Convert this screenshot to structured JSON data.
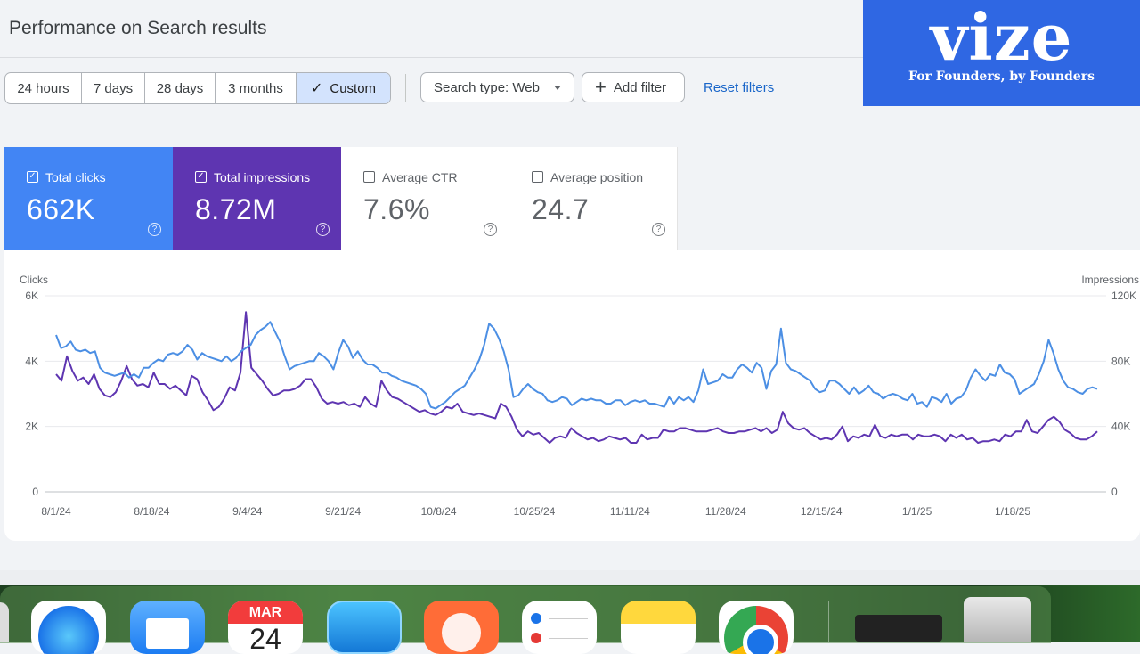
{
  "header": {
    "title": "Performance on Search results"
  },
  "date_ranges": [
    {
      "label": "24 hours",
      "active": false
    },
    {
      "label": "7 days",
      "active": false
    },
    {
      "label": "28 days",
      "active": false
    },
    {
      "label": "3 months",
      "active": false
    },
    {
      "label": "Custom",
      "active": true
    }
  ],
  "filters": {
    "search_type": "Search type: Web",
    "add_filter": "Add filter",
    "reset": "Reset filters"
  },
  "logo": {
    "word": "vize",
    "tagline": "For Founders, by Founders"
  },
  "metrics": {
    "clicks": {
      "label": "Total clicks",
      "value": "662K",
      "checked": true,
      "color": "#4285f4"
    },
    "impressions": {
      "label": "Total impressions",
      "value": "8.72M",
      "checked": true,
      "color": "#5e35b1"
    },
    "ctr": {
      "label": "Average CTR",
      "value": "7.6%",
      "checked": false
    },
    "position": {
      "label": "Average position",
      "value": "24.7",
      "checked": false
    }
  },
  "chart_data": {
    "type": "line",
    "ylabel_left": "Clicks",
    "ylabel_right": "Impressions",
    "y_left_ticks": [
      "0",
      "2K",
      "4K",
      "6K"
    ],
    "y_right_ticks": [
      "0",
      "40K",
      "80K",
      "120K"
    ],
    "ylim_left": [
      0,
      6000
    ],
    "ylim_right": [
      0,
      120000
    ],
    "x_ticks": [
      "8/1/24",
      "8/18/24",
      "9/4/24",
      "9/21/24",
      "10/8/24",
      "10/25/24",
      "11/11/24",
      "11/28/24",
      "12/15/24",
      "1/1/25",
      "1/18/25"
    ],
    "grid": true,
    "series": [
      {
        "name": "Clicks",
        "axis": "left",
        "color": "#5e35b1",
        "values": [
          3600,
          3400,
          4150,
          3700,
          3400,
          3500,
          3300,
          3600,
          3150,
          2950,
          2900,
          3050,
          3400,
          3850,
          3450,
          3250,
          3300,
          3200,
          3650,
          3300,
          3300,
          3150,
          3250,
          3100,
          2950,
          3550,
          3450,
          3050,
          2800,
          2500,
          2600,
          2850,
          3200,
          3100,
          3650,
          5500,
          3800,
          3600,
          3400,
          3150,
          2950,
          3000,
          3100,
          3100,
          3150,
          3250,
          3450,
          3450,
          3200,
          2850,
          2700,
          2750,
          2700,
          2750,
          2650,
          2700,
          2600,
          2900,
          2700,
          2600,
          3400,
          3100,
          2900,
          2850,
          2750,
          2650,
          2550,
          2450,
          2500,
          2400,
          2350,
          2450,
          2600,
          2550,
          2700,
          2450,
          2400,
          2350,
          2400,
          2350,
          2300,
          2250,
          2700,
          2600,
          2300,
          1900,
          1700,
          1850,
          1750,
          1800,
          1650,
          1500,
          1650,
          1700,
          1650,
          1950,
          1800,
          1700,
          1600,
          1650,
          1550,
          1600,
          1700,
          1650,
          1600,
          1650,
          1500,
          1500,
          1750,
          1600,
          1650,
          1650,
          1900,
          1850,
          1850,
          1950,
          1950,
          1900,
          1850,
          1850,
          1850,
          1900,
          1950,
          1850,
          1800,
          1800,
          1850,
          1850,
          1900,
          1950,
          1850,
          1950,
          1800,
          1900,
          2450,
          2100,
          1950,
          1900,
          1950,
          1800,
          1700,
          1600,
          1650,
          1600,
          1750,
          2000,
          1550,
          1700,
          1650,
          1750,
          1700,
          2050,
          1700,
          1650,
          1750,
          1700,
          1750,
          1750,
          1600,
          1750,
          1700,
          1700,
          1750,
          1700,
          1550,
          1750,
          1650,
          1750,
          1600,
          1650,
          1500,
          1550,
          1550,
          1600,
          1550,
          1750,
          1700,
          1850,
          1850,
          2200,
          1850,
          1800,
          2000,
          2200,
          2300,
          2150,
          1900,
          1800,
          1650,
          1600,
          1600,
          1700,
          1850
        ]
      },
      {
        "name": "Impressions",
        "axis": "right",
        "color": "#4c8fe4",
        "values": [
          96000,
          88000,
          89000,
          92000,
          87000,
          86000,
          87000,
          85000,
          86000,
          76000,
          73000,
          72000,
          71000,
          72000,
          73000,
          70000,
          72000,
          70000,
          76000,
          76000,
          79000,
          81000,
          80000,
          84000,
          85000,
          84000,
          86000,
          90000,
          87000,
          81000,
          85000,
          83000,
          82000,
          81000,
          80000,
          83000,
          80000,
          82000,
          86000,
          88000,
          90000,
          96000,
          99000,
          101000,
          104000,
          98000,
          92000,
          83000,
          75000,
          77000,
          78000,
          79000,
          80000,
          80000,
          85000,
          83000,
          80000,
          75000,
          85000,
          93000,
          89000,
          82000,
          86000,
          81000,
          78000,
          78000,
          76000,
          73000,
          73000,
          71000,
          70000,
          68000,
          67000,
          66000,
          65000,
          63000,
          60000,
          52000,
          51000,
          53000,
          55000,
          58000,
          61000,
          63000,
          65000,
          70000,
          75000,
          81000,
          90000,
          103000,
          100000,
          94000,
          86000,
          75000,
          58000,
          59000,
          63000,
          66000,
          63000,
          61000,
          60000,
          56000,
          55000,
          56000,
          58000,
          57000,
          53000,
          55000,
          57000,
          56000,
          57000,
          56000,
          56000,
          54000,
          54000,
          56000,
          56000,
          53000,
          55000,
          56000,
          55000,
          56000,
          54000,
          54000,
          53000,
          52000,
          58000,
          54000,
          58000,
          56000,
          58000,
          55000,
          62000,
          75000,
          66000,
          67000,
          68000,
          72000,
          70000,
          70000,
          75000,
          78000,
          76000,
          73000,
          79000,
          76000,
          63000,
          74000,
          78000,
          100000,
          79000,
          75000,
          74000,
          72000,
          70000,
          68000,
          63000,
          61000,
          62000,
          68000,
          68000,
          66000,
          63000,
          60000,
          64000,
          60000,
          62000,
          65000,
          61000,
          60000,
          57000,
          59000,
          60000,
          59000,
          57000,
          56000,
          60000,
          54000,
          55000,
          52000,
          58000,
          57000,
          55000,
          60000,
          54000,
          57000,
          58000,
          62000,
          70000,
          75000,
          71000,
          68000,
          72000,
          71000,
          78000,
          73000,
          72000,
          69000,
          60000,
          62000,
          64000,
          66000,
          72000,
          80000,
          93000,
          85000,
          75000,
          68000,
          64000,
          63000,
          61000,
          60000,
          63000,
          64000,
          63000
        ]
      }
    ]
  },
  "dock": {
    "calendar_month": "MAR",
    "calendar_day": "24",
    "apps": [
      "safari-icon",
      "mail-icon",
      "calendar-icon",
      "xcode-icon",
      "postman-icon",
      "reminders-icon",
      "notes-icon",
      "chrome-icon",
      "terminal-icon",
      "trash-icon"
    ]
  }
}
